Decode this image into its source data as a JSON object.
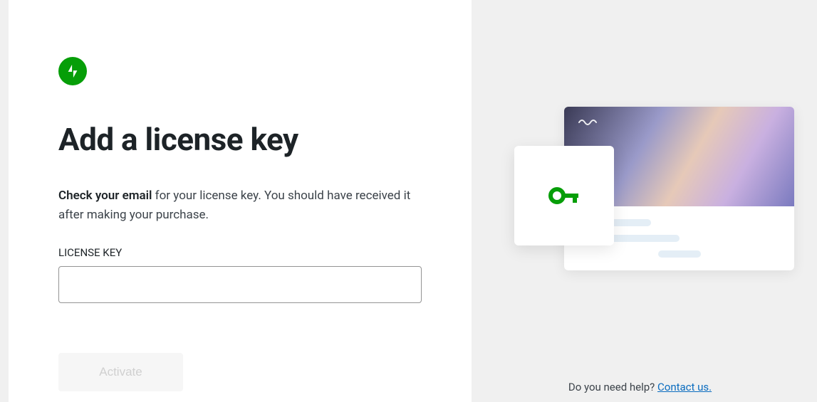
{
  "logo": {
    "name": "jetpack-logo"
  },
  "title": "Add a license key",
  "instruction_bold": "Check your email",
  "instruction_rest": " for your license key. You should have received it after making your purchase.",
  "field_label": "LICENSE KEY",
  "license_value": "",
  "activate_label": "Activate",
  "help": {
    "question": "Do you need help? ",
    "link_text": "Contact us."
  },
  "colors": {
    "brand_green": "#069e08"
  }
}
